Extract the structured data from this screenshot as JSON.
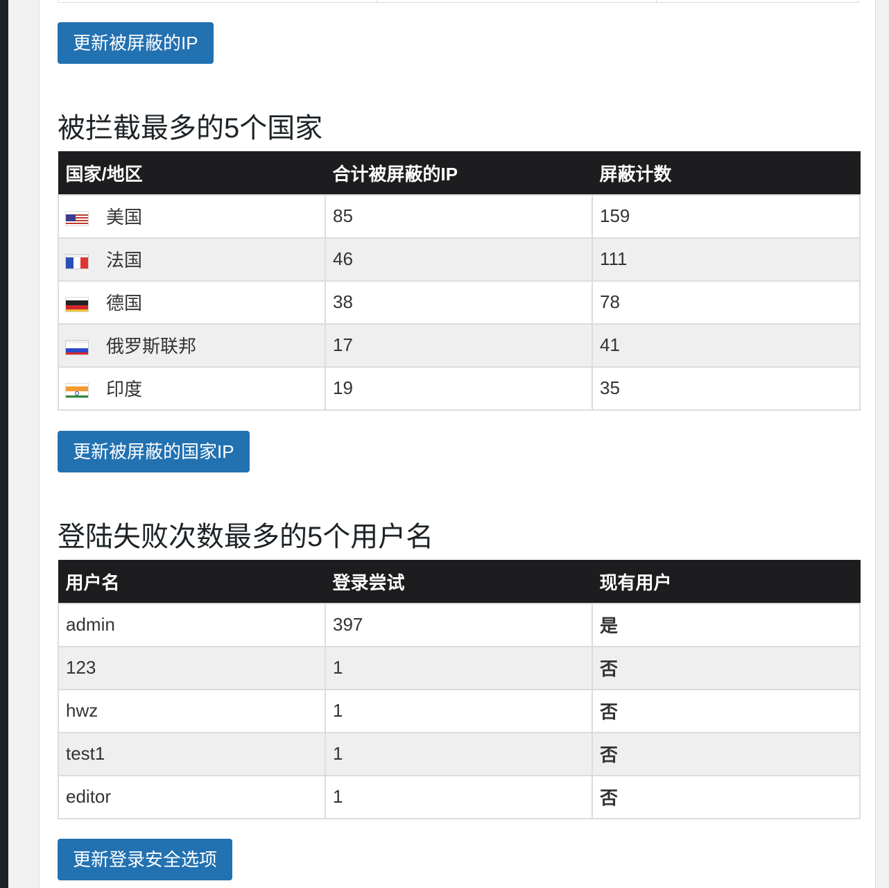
{
  "buttons": {
    "update_blocked_ip": "更新被屏蔽的IP",
    "update_blocked_country_ip": "更新被屏蔽的国家IP",
    "update_login_security": "更新登录安全选项"
  },
  "countries": {
    "heading": "被拦截最多的5个国家",
    "columns": [
      "国家/地区",
      "合计被屏蔽的IP",
      "屏蔽计数"
    ],
    "rows": [
      {
        "flag": "us-flag-icon",
        "name": "美国",
        "ips": "85",
        "count": "159"
      },
      {
        "flag": "fr-flag-icon",
        "name": "法国",
        "ips": "46",
        "count": "111"
      },
      {
        "flag": "de-flag-icon",
        "name": "德国",
        "ips": "38",
        "count": "78"
      },
      {
        "flag": "ru-flag-icon",
        "name": "俄罗斯联邦",
        "ips": "17",
        "count": "41"
      },
      {
        "flag": "in-flag-icon",
        "name": "印度",
        "ips": "19",
        "count": "35"
      }
    ]
  },
  "usernames": {
    "heading": "登陆失败次数最多的5个用户名",
    "columns": [
      "用户名",
      "登录尝试",
      "现有用户"
    ],
    "rows": [
      {
        "user": "admin",
        "attempts": "397",
        "exists": "是"
      },
      {
        "user": "123",
        "attempts": "1",
        "exists": "否"
      },
      {
        "user": "hwz",
        "attempts": "1",
        "exists": "否"
      },
      {
        "user": "test1",
        "attempts": "1",
        "exists": "否"
      },
      {
        "user": "editor",
        "attempts": "1",
        "exists": "否"
      }
    ]
  },
  "colors": {
    "button": "#2271b1",
    "header_bg": "#1d1d1f",
    "yes": "#2db83d",
    "no": "#d63638"
  }
}
